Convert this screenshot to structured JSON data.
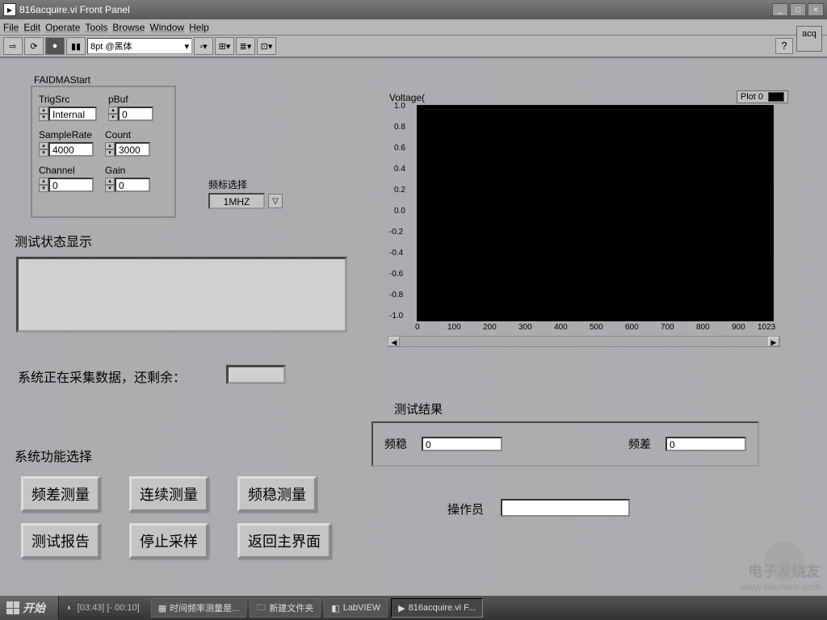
{
  "window": {
    "title": "816acquire.vi Front Panel"
  },
  "menu": {
    "file": "File",
    "edit": "Edit",
    "operate": "Operate",
    "tools": "Tools",
    "browse": "Browse",
    "window": "Window",
    "help": "Help"
  },
  "toolbar": {
    "font": "8pt @黑体",
    "acq_label": "acq"
  },
  "faidma": {
    "title": "FAIDMAStart",
    "trigsrc": {
      "label": "TrigSrc",
      "value": "Internal"
    },
    "pbuf": {
      "label": "pBuf",
      "value": "0"
    },
    "samplerate": {
      "label": "SampleRate",
      "value": "4000"
    },
    "count": {
      "label": "Count",
      "value": "3000"
    },
    "channel": {
      "label": "Channel",
      "value": "0"
    },
    "gain": {
      "label": "Gain",
      "value": "0"
    }
  },
  "freq_select": {
    "label": "频标选择",
    "value": "1MHZ"
  },
  "status": {
    "title": "测试状态显示",
    "collecting": "系统正在采集数据，还剩余："
  },
  "functions": {
    "title": "系统功能选择",
    "btn_freqdiff": "频差测量",
    "btn_continuous": "连续测量",
    "btn_freqstab": "频稳测量",
    "btn_report": "测试报告",
    "btn_stop": "停止采样",
    "btn_return": "返回主界面"
  },
  "graph": {
    "title": "Voltage(",
    "legend": "Plot 0"
  },
  "results": {
    "title": "测试结果",
    "freqstab_label": "频稳",
    "freqstab_value": "0",
    "freqdiff_label": "频差",
    "freqdiff_value": "0",
    "operator_label": "操作员"
  },
  "taskbar": {
    "start": "开始",
    "time": "[03:43] [- 00:10]",
    "task1": "时间频率测量是...",
    "task2": "新建文件夹",
    "task3": "LabVIEW",
    "task4": "816acquire.vi F..."
  },
  "watermark": {
    "line1": "电子发烧友",
    "line2": "www.elecfans.com"
  },
  "chart_data": {
    "type": "line",
    "title": "Voltage(",
    "xlabel": "",
    "ylabel": "",
    "xlim": [
      0,
      1023
    ],
    "ylim": [
      -1.0,
      1.0
    ],
    "x_ticks": [
      0,
      100,
      200,
      300,
      400,
      500,
      600,
      700,
      800,
      900,
      1023
    ],
    "y_ticks": [
      -1.0,
      -0.8,
      -0.6,
      -0.4,
      -0.2,
      0.0,
      0.2,
      0.4,
      0.6,
      0.8,
      1.0
    ],
    "series": [
      {
        "name": "Plot 0",
        "x": [],
        "y": []
      }
    ]
  }
}
